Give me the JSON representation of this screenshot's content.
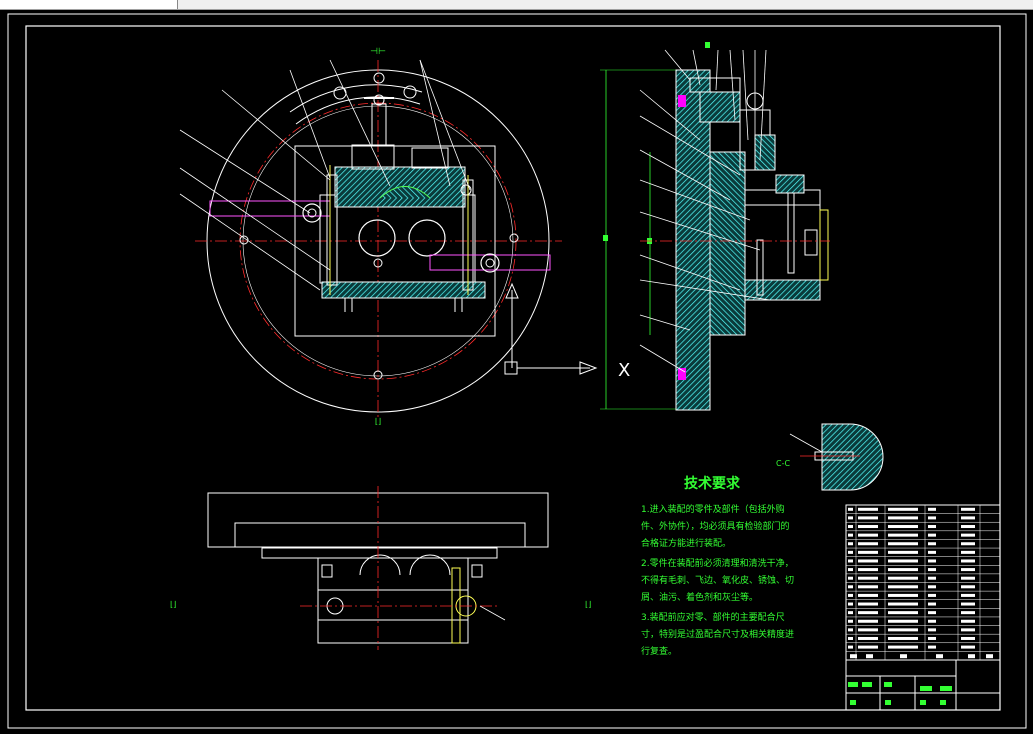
{
  "window": {
    "tab_label": ""
  },
  "drawing": {
    "tech_title": "技术要求",
    "tech_requirements": [
      "1.进入装配的零件及部件（包括外购",
      "件、外协件），均必须具有检验部门的",
      "合格证方能进行装配。",
      "2.零件在装配前必须清理和清洗干净，",
      "不得有毛刺、飞边、氧化皮、锈蚀、切",
      "屑、油污、着色剂和灰尘等。",
      "3.装配前应对零、部件的主要配合尺",
      "寸，特别是过盈配合尺寸及相关精度进",
      "行复查。"
    ],
    "view_marker": "X",
    "colors": {
      "background": "#000000",
      "outline": "#ffffff",
      "centerline": "#ff2a2a",
      "dimension": "#33ff33",
      "hatch": "#55ffff",
      "accent": "#ff00ff",
      "parts": "#ffff55"
    }
  }
}
